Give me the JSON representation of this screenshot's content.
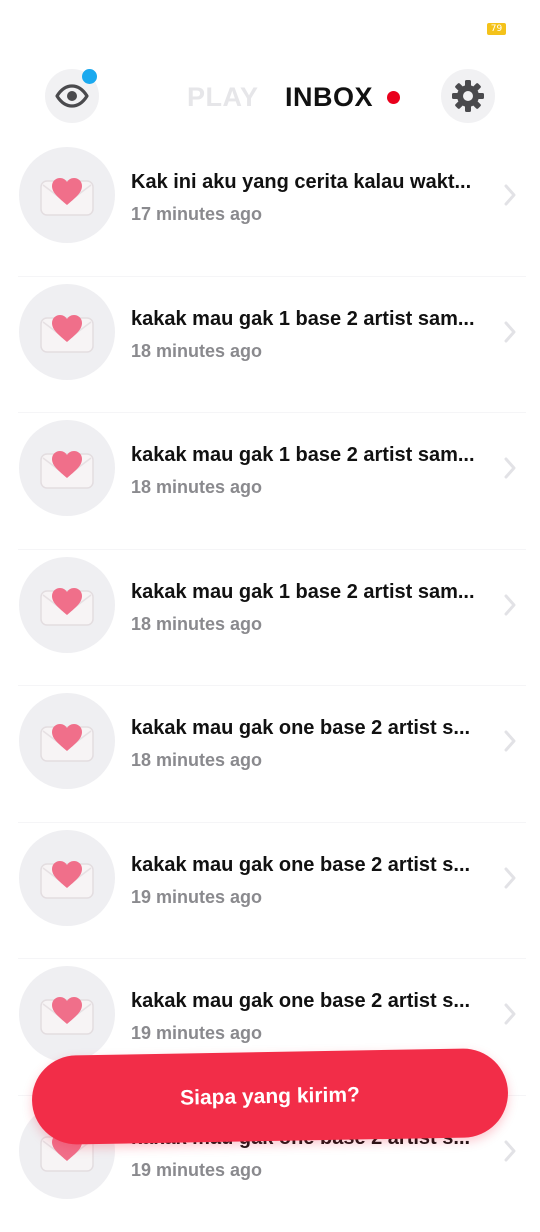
{
  "status_bar": {
    "battery_level": "79"
  },
  "header": {
    "tab_play": "PLAY",
    "tab_inbox": "INBOX",
    "icons": {
      "left": "eye-icon",
      "right": "gear-icon"
    }
  },
  "messages": [
    {
      "title": "Kak ini aku yang cerita kalau wakt...",
      "time": "17 minutes ago"
    },
    {
      "title": "kakak mau gak 1 base 2 artist sam...",
      "time": "18 minutes ago"
    },
    {
      "title": "kakak mau gak 1 base 2 artist sam...",
      "time": "18 minutes ago"
    },
    {
      "title": "kakak mau gak 1 base 2 artist sam...",
      "time": "18 minutes ago"
    },
    {
      "title": "kakak mau gak one base 2 artist s...",
      "time": "18 minutes ago"
    },
    {
      "title": "kakak mau gak one base 2 artist s...",
      "time": "19 minutes ago"
    },
    {
      "title": "kakak mau gak one base 2 artist s...",
      "time": "19 minutes ago"
    },
    {
      "title": "kakak mau gak one base 2 artist s...",
      "time": "19 minutes ago"
    }
  ],
  "cta": {
    "label": "Siapa yang kirim?"
  },
  "colors": {
    "accent": "#f22d48",
    "notification_blue": "#1aa9ef",
    "unread_red": "#e9001c",
    "battery": "#f4c21a"
  }
}
